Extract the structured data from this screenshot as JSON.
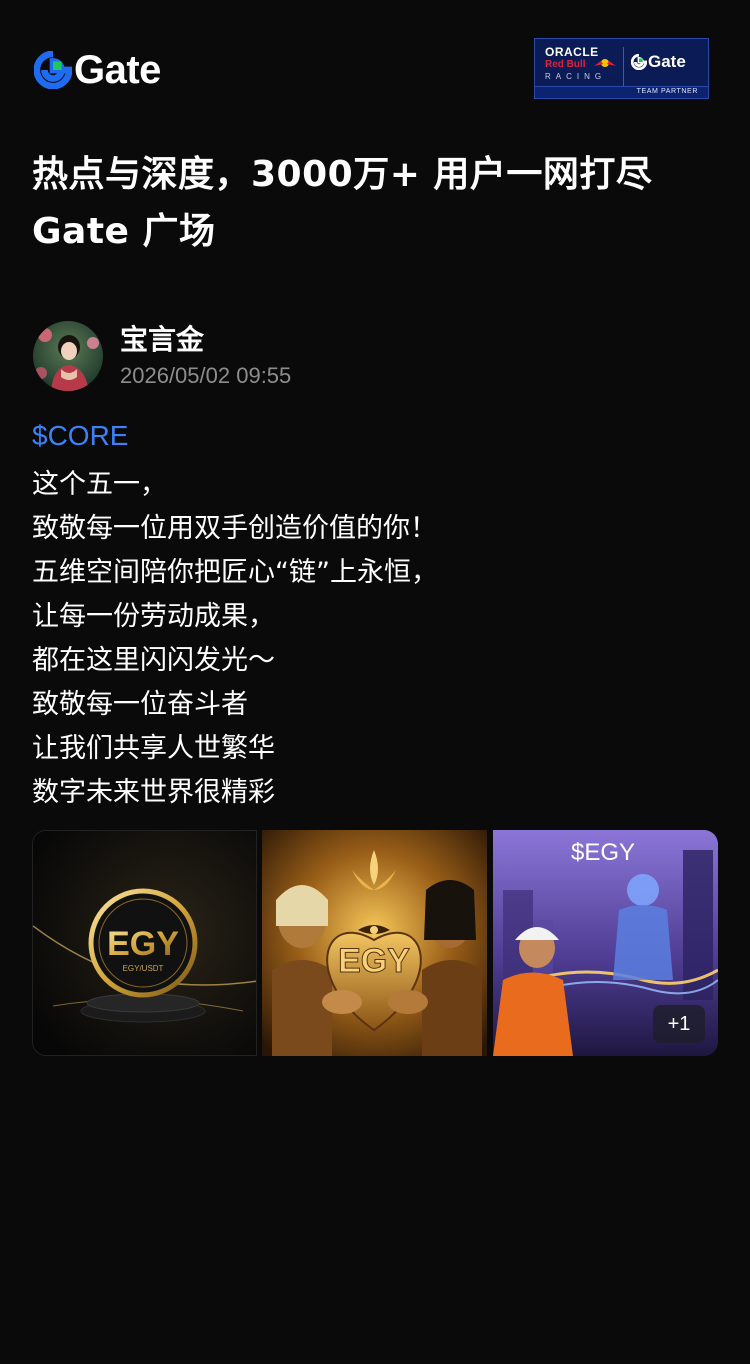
{
  "brand": {
    "name": "Gate",
    "accent": "#1d4ed8",
    "accent_green": "#22c55e"
  },
  "partner": {
    "oracle": "ORACLE",
    "redbull": "Red Bull",
    "racing": "RACING",
    "gate": "Gate",
    "tagline": "TEAM PARTNER"
  },
  "headline": {
    "line1": "热点与深度，3000万+ 用户一网打尽",
    "line2": "Gate 广场"
  },
  "post": {
    "author": "宝言金",
    "timestamp": "2026/05/02 09:55",
    "ticker": "$CORE",
    "lines": [
      "这个五一，",
      "致敬每一位用双手创造价值的你！",
      "五维空间陪你把匠心“链”上永恒，",
      "让每一份劳动成果，",
      "都在这里闪闪发光～",
      "致敬每一位奋斗者",
      "让我们共享人世繁华",
      "数字未来世界很精彩"
    ],
    "images": [
      {
        "logo": "EGY",
        "caption": "EGY/USDT"
      },
      {
        "logo": "EGY"
      },
      {
        "logo": "$EGY"
      }
    ],
    "more_images": "+1"
  }
}
